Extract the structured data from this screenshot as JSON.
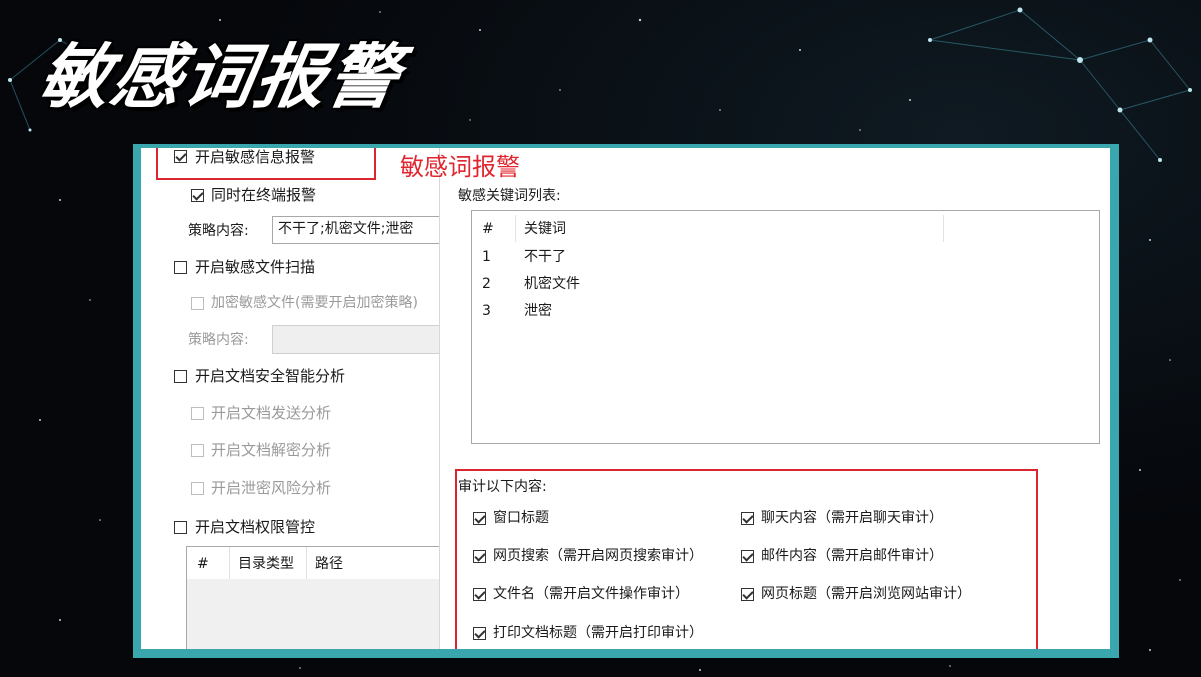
{
  "slide": {
    "title": "敏感词报警"
  },
  "left_panel": {
    "enable_sensitive_alarm": {
      "label": "开启敏感信息报警",
      "checked": true,
      "enabled": true
    },
    "terminal_alarm": {
      "label": "同时在终端报警",
      "checked": true,
      "enabled": true
    },
    "policy_label": "策略内容:",
    "policy_value": "不干了;机密文件;泄密",
    "file_scan": {
      "label": "开启敏感文件扫描",
      "checked": false,
      "enabled": true
    },
    "encrypt_sensitive": {
      "label": "加密敏感文件(需要开启加密策略)",
      "checked": false,
      "enabled": false
    },
    "policy_label_2": "策略内容:",
    "policy_value_2": "",
    "doc_analysis": {
      "label": "开启文档安全智能分析",
      "checked": false,
      "enabled": true
    },
    "doc_send": {
      "label": "开启文档发送分析",
      "checked": false,
      "enabled": false
    },
    "doc_decrypt": {
      "label": "开启文档解密分析",
      "checked": false,
      "enabled": false
    },
    "leak_risk": {
      "label": "开启泄密风险分析",
      "checked": false,
      "enabled": false
    },
    "doc_permission": {
      "label": "开启文档权限管控",
      "checked": false,
      "enabled": true
    },
    "dir_table": {
      "headers": [
        "#",
        "目录类型",
        "路径"
      ]
    }
  },
  "right_panel": {
    "red_heading": "敏感词报警",
    "keyword_list_label": "敏感关键词列表:",
    "keyword_table": {
      "headers": [
        "#",
        "关键词"
      ],
      "rows": [
        {
          "index": "1",
          "keyword": "不干了"
        },
        {
          "index": "2",
          "keyword": "机密文件"
        },
        {
          "index": "3",
          "keyword": "泄密"
        }
      ]
    },
    "audit_label": "审计以下内容:",
    "audit_items": {
      "window_title": {
        "label": "窗口标题",
        "checked": true
      },
      "chat_content": {
        "label": "聊天内容（需开启聊天审计）",
        "checked": true
      },
      "web_search": {
        "label": "网页搜索（需开启网页搜索审计）",
        "checked": true
      },
      "mail_content": {
        "label": "邮件内容（需开启邮件审计）",
        "checked": true
      },
      "file_name": {
        "label": "文件名（需开启文件操作审计）",
        "checked": true
      },
      "web_title": {
        "label": "网页标题（需开启浏览网站审计）",
        "checked": true
      },
      "print_title": {
        "label": "打印文档标题（需开启打印审计）",
        "checked": true
      }
    }
  },
  "colors": {
    "frame": "#3aa6ad",
    "highlight": "#d9262e",
    "background": "#05070b"
  }
}
